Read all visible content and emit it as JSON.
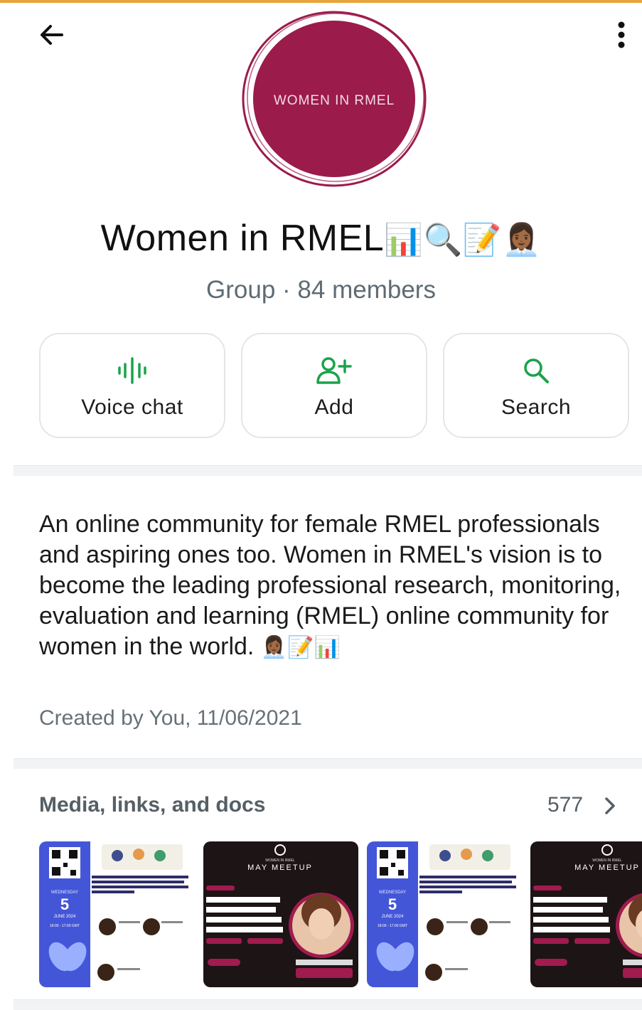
{
  "header": {
    "back_icon": "arrow-left-icon",
    "menu_icon": "more-vert-icon"
  },
  "group": {
    "avatar_text": "WOMEN IN RMEL",
    "name": "Women in RMEL",
    "name_emoji": "📊🔍📝👩🏾‍💼",
    "meta": "Group · 84 members"
  },
  "actions": [
    {
      "label": "Voice chat",
      "icon": "voice-chat-icon"
    },
    {
      "label": "Add",
      "icon": "add-person-icon"
    },
    {
      "label": "Search",
      "icon": "search-icon"
    }
  ],
  "about": {
    "description": "An online community for female RMEL professionals and aspiring ones too. Women in RMEL's vision is to become the leading professional research, monitoring, evaluation and learning (RMEL) online community for women in the world.",
    "description_emoji": "👩🏾‍💼📝📊",
    "created": "Created by You, 11/06/2021"
  },
  "media": {
    "title": "Media, links, and docs",
    "count": "577",
    "thumbnails": [
      {
        "kind": "event-poster",
        "heading": "Communities of Practice within the M and E sector: The Case of Women in Research, Monitoring, Evaluation and Learning",
        "day_name": "WEDNESDAY",
        "day": "5",
        "month": "JUNE 2024",
        "time": "18:00 - 17:00 GMT"
      },
      {
        "kind": "meetup-poster",
        "brand": "WOMEN IN RMEL",
        "heading": "MAY MEETUP",
        "topic": "HELPING MONITORING AND EVALUATION PROFESSIONALS TO NAVIGATE AN AI WORLD",
        "date": "30TH MAY 2024",
        "time": "4PM UTC",
        "speaker": "STEPHANIE BARNES",
        "role": "SPEAKER"
      },
      {
        "kind": "event-poster",
        "heading": "Communities of Practice within the M and E sector: The Case of Women in Research, Monitoring, Evaluation and Learning",
        "day_name": "WEDNESDAY",
        "day": "5",
        "month": "JUNE 2024",
        "time": "18:00 - 17:00 GMT"
      },
      {
        "kind": "meetup-poster",
        "brand": "WOMEN IN RMEL",
        "heading": "MAY MEETUP",
        "topic": "HELPING MONITORING AND EVALUATION PROFESSIONALS TO NAVIGATE AN AI WORLD",
        "date": "30TH MAY 2024",
        "time": "4PM UTC",
        "speaker": "STEPHANIE BARNES",
        "role": "SPEAKER"
      }
    ]
  },
  "colors": {
    "accent_green": "#1aa34a",
    "avatar_maroon": "#9b1b4b",
    "status_bar": "#e8a33a",
    "poster_blue": "#4456d8"
  }
}
